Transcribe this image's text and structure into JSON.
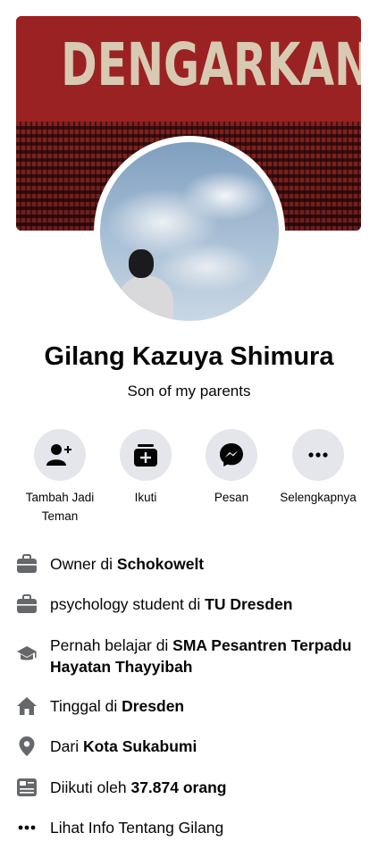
{
  "cover": {
    "banner_text": "DENGARKAN!"
  },
  "profile": {
    "name": "Gilang Kazuya Shimura",
    "bio": "Son of my parents"
  },
  "actions": [
    {
      "label": "Tambah Jadi Teman",
      "icon": "add-friend-icon"
    },
    {
      "label": "Ikuti",
      "icon": "follow-icon"
    },
    {
      "label": "Pesan",
      "icon": "messenger-icon"
    },
    {
      "label": "Selengkapnya",
      "icon": "more-icon"
    }
  ],
  "intro": {
    "work1": {
      "prefix": "Owner di ",
      "place": "Schokowelt"
    },
    "work2": {
      "prefix": "psychology student di ",
      "place": "TU Dresden"
    },
    "education": {
      "prefix": "Pernah belajar di ",
      "place": "SMA Pesantren Terpadu Hayatan Thayyibah"
    },
    "lives": {
      "prefix": "Tinggal di ",
      "place": "Dresden"
    },
    "from": {
      "prefix": "Dari ",
      "place": "Kota Sukabumi"
    },
    "followers": {
      "prefix": "Diikuti oleh ",
      "count": "37.874 orang"
    },
    "see_about": "Lihat Info Tentang Gilang"
  },
  "colors": {
    "icon_gray": "#65676b",
    "button_bg": "#e4e6eb",
    "text": "#050505"
  }
}
